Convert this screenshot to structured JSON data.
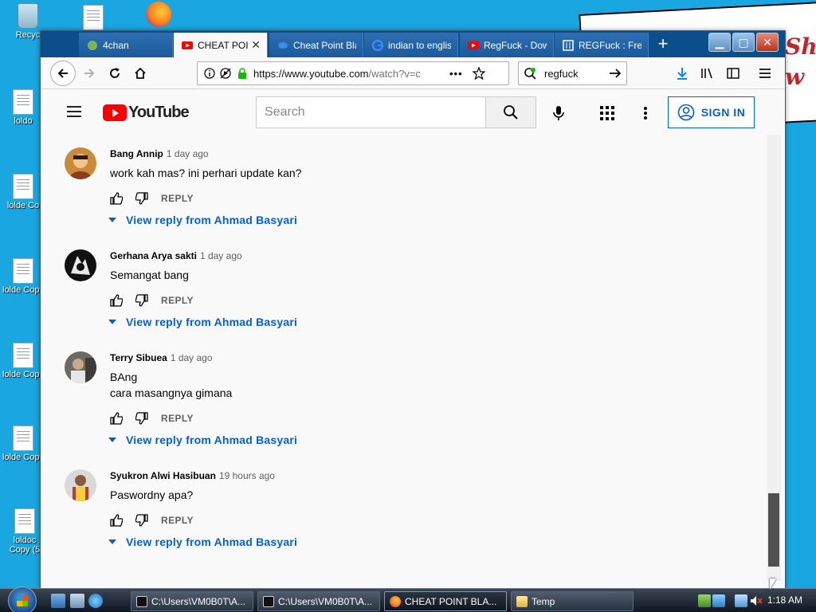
{
  "desktop": {
    "icons": [
      "Recyc",
      "loldo",
      "lolde Co",
      "lolde Copy",
      "lolde Copy",
      "lolde Copy",
      "loldoc Copy (5"
    ],
    "background_text": [
      "Shit",
      "w"
    ]
  },
  "browser": {
    "tabs": [
      {
        "label": "4chan",
        "icon": "4chan-favicon"
      },
      {
        "label": "CHEAT POINT BLANK",
        "icon": "youtube-favicon",
        "active": true
      },
      {
        "label": "Cheat Point Blank",
        "icon": "cheat-point-favicon"
      },
      {
        "label": "indian to english",
        "icon": "google-favicon"
      },
      {
        "label": "RegFuck - Download",
        "icon": "youtube-favicon"
      },
      {
        "label": "REGFuck : Free",
        "icon": "archive-favicon"
      }
    ],
    "url": "https://www.youtube.com/watch?v=c",
    "url_host": "https://www.youtube.com",
    "url_path": "/watch?v=c",
    "search_value": "regfuck"
  },
  "youtube": {
    "search_placeholder": "Search",
    "logo_text": "YouTube",
    "sign_in_label": "SIGN IN",
    "comments": [
      {
        "author": "Bang Annip",
        "time": "1 day ago",
        "text": "work kah mas?  ini perhari update kan?",
        "reply_label": "REPLY",
        "replies_label": "View reply from Ahmad Basyari"
      },
      {
        "author": "Gerhana Arya sakti",
        "time": "1 day ago",
        "text": "Semangat bang",
        "reply_label": "REPLY",
        "replies_label": "View reply from Ahmad Basyari"
      },
      {
        "author": "Terry Sibuea",
        "time": "1 day ago",
        "text": "BAng\ncara masangnya gimana",
        "reply_label": "REPLY",
        "replies_label": "View reply from Ahmad Basyari"
      },
      {
        "author": "Syukron Alwi Hasibuan",
        "time": "19 hours ago",
        "text": "Paswordny apa?",
        "reply_label": "REPLY",
        "replies_label": "View reply from Ahmad Basyari"
      }
    ]
  },
  "taskbar": {
    "tasks": [
      {
        "label": "C:\\Users\\VM0B0T\\A...",
        "icon": "7zip-icon"
      },
      {
        "label": "C:\\Users\\VM0B0T\\A...",
        "icon": "7zip-icon"
      },
      {
        "label": "CHEAT POINT BLA...",
        "icon": "firefox-icon",
        "active": true
      },
      {
        "label": "Temp",
        "icon": "folder-icon"
      }
    ],
    "clock": "1:18 AM"
  },
  "colors": {
    "desktop": "#1aa6e0",
    "tabstrip": "#0c4e8c",
    "youtube_red": "#ff0000",
    "link_blue": "#065fd4"
  }
}
